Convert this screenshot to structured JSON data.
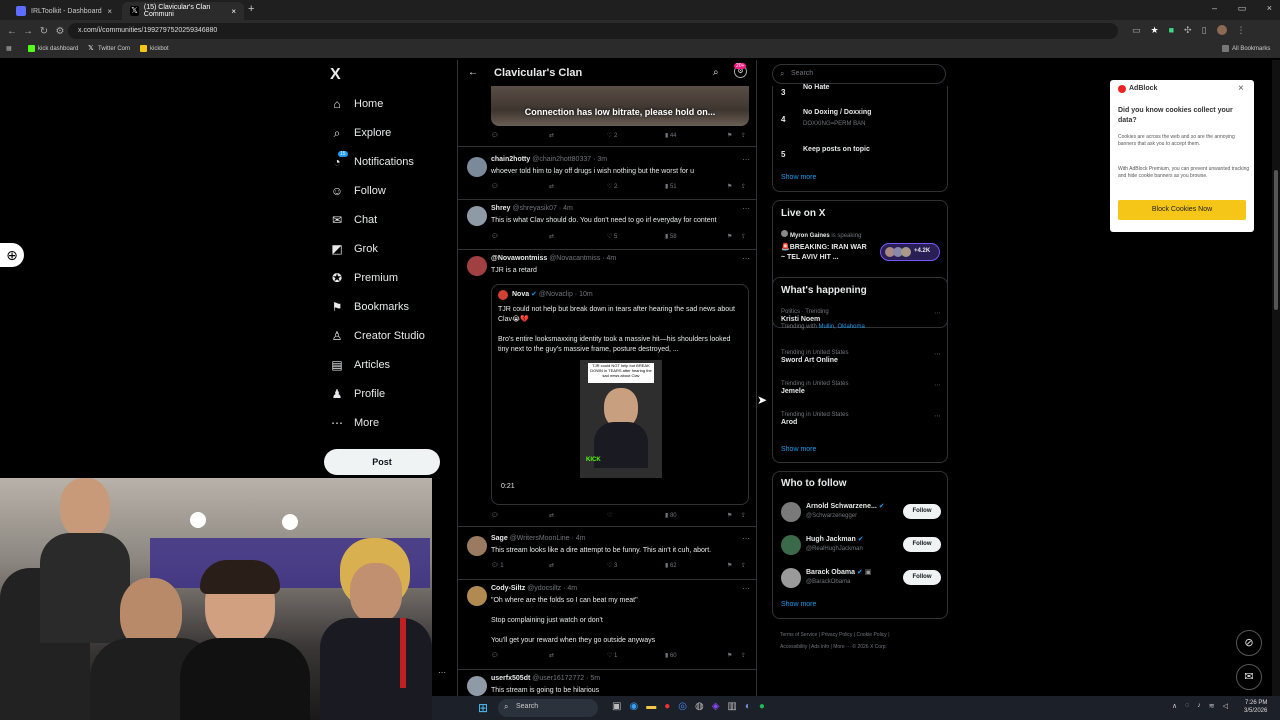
{
  "browser": {
    "tabs": [
      {
        "label": "IRLToolkit - Dashboard",
        "close": "×"
      },
      {
        "label": "(15) Clavicular's Clan Communi",
        "close": "×"
      }
    ],
    "new_tab": "+",
    "url": "x.com/i/communities/1992797520259346880",
    "bookmarks": [
      "kick dashboard",
      "Twitter Com",
      "kickbot"
    ],
    "all_bookmarks": "All Bookmarks",
    "window_controls": [
      "–",
      "▭",
      "×"
    ]
  },
  "nav": {
    "logo": "X",
    "items": [
      {
        "label": "Home",
        "icon": "⌂"
      },
      {
        "label": "Explore",
        "icon": "⌕"
      },
      {
        "label": "Notifications",
        "icon": "◔"
      },
      {
        "label": "Follow",
        "icon": "☺"
      },
      {
        "label": "Chat",
        "icon": "✉"
      },
      {
        "label": "Grok",
        "icon": "◩"
      },
      {
        "label": "Premium",
        "icon": "✪"
      },
      {
        "label": "Bookmarks",
        "icon": "⚑"
      },
      {
        "label": "Creator Studio",
        "icon": "♙"
      },
      {
        "label": "Articles",
        "icon": "▤"
      },
      {
        "label": "Profile",
        "icon": "♟"
      },
      {
        "label": "More",
        "icon": "⋯"
      }
    ],
    "notif_badge": "15",
    "post_label": "Post"
  },
  "feed": {
    "title": "Clavicular's Clan",
    "badge": "20+",
    "media_banner": "Connection has low bitrate, please hold on...",
    "top_actions": {
      "likes": "2",
      "views": "44"
    },
    "tweets": [
      {
        "name": "chain2hotty",
        "handle": "@chain2hott80337 · 3m",
        "text": "whoever told him to lay off drugs i wish nothing but the worst for u",
        "likes": "2",
        "views": "51"
      },
      {
        "name": "Shrey",
        "handle": "@shreyasik07 · 4m",
        "text": "This is what Clav should do. You don't need to go irl everyday for content",
        "likes": "5",
        "views": "58"
      },
      {
        "name": "@Novawontmiss",
        "handle": "@Novacantmiss · 4m",
        "text": "TJR is a retard",
        "views": "80"
      },
      {
        "name": "Sage",
        "handle": "@WritersMoonLine · 4m",
        "text": "This stream looks like a dire attempt to be funny. This ain't it cuh, abort.",
        "replies": "1",
        "likes": "3",
        "views": "62"
      },
      {
        "name": "Cody-Siltz",
        "handle": "@ydocsiltz · 4m",
        "text": "\"Oh where are the folds so I can beat my meat\"",
        "text2": "Stop complaining just watch or don't",
        "text3": "You'll get your reward when they go outside anyways",
        "likes": "1",
        "views": "60"
      },
      {
        "name": "userfx505dt",
        "handle": "@user16172772 · 5m",
        "text": "This stream is going to be hilarious"
      }
    ],
    "quote": {
      "name": "Nova",
      "handle": "@Novaclip · 10m",
      "text1": "TJR could not help but break down in tears after hearing the sad news about Clav😭💔",
      "text2": "Bro's entire looksmaxxing identity took a massive hit—his shoulders looked tiny next to the guy's massive frame, posture destroyed, ...",
      "duration": "0:21",
      "video_caption": "TJR could NOT help but BREAK DOWN in TEARS after hearing the sad news about Clav",
      "video_sub": "KICK"
    }
  },
  "right": {
    "search_placeholder": "Search",
    "rules": [
      {
        "num": "3",
        "title": "No Hate",
        "sub": ""
      },
      {
        "num": "4",
        "title": "No Doxing / Doxxing",
        "sub": "DOXXING=PERM BAN"
      },
      {
        "num": "5",
        "title": "Keep posts on topic",
        "sub": ""
      }
    ],
    "show_more": "Show more",
    "live": {
      "title": "Live on X",
      "host": "Myron Gaines",
      "status": "is speaking",
      "headline": "🚨BREAKING: IRAN WAR ~ TEL AVIV HIT ...",
      "count": "+4.2K"
    },
    "happening": {
      "title": "What's happening",
      "trends": [
        {
          "ctx": "Politics · Trending",
          "name": "Kristi Noem",
          "extra_pre": "Trending with",
          "extra": "Mullin, Oklahoma"
        },
        {
          "ctx": "Trending in United States",
          "name": "Sword Art Online"
        },
        {
          "ctx": "Trending in United States",
          "name": "Jemele"
        },
        {
          "ctx": "Trending in United States",
          "name": "Arod"
        }
      ]
    },
    "who": {
      "title": "Who to follow",
      "follow_label": "Follow",
      "users": [
        {
          "name": "Arnold Schwarzene...",
          "handle": "@Schwarzenegger"
        },
        {
          "name": "Hugh Jackman",
          "handle": "@RealHughJackman"
        },
        {
          "name": "Barack Obama",
          "handle": "@BarackObama"
        }
      ]
    },
    "footer": [
      "Terms of Service",
      "Privacy Policy",
      "Cookie Policy",
      "Accessibility",
      "Ads info",
      "More ···",
      "© 2026 X Corp."
    ]
  },
  "adblock": {
    "brand": "AdBlock",
    "heading": "Did you know cookies collect your data?",
    "p1": "Cookies are across the web and so are the annoying banners that ask you to accept them.",
    "p2": "With AdBlock Premium, you can prevent unwanted tracking and hide cookie banners as you browse.",
    "button": "Block Cookies Now"
  },
  "taskbar": {
    "search": "Search",
    "time": "7:26 PM",
    "date": "3/5/2026"
  },
  "colors": {
    "accent": "#1d9bf0",
    "adblock_button": "#f5c518",
    "x_bg": "#000000"
  }
}
